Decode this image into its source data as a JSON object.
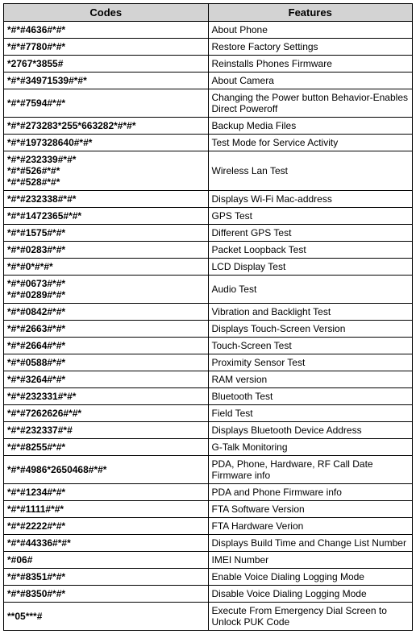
{
  "headers": {
    "codes": "Codes",
    "features": "Features"
  },
  "rows": [
    {
      "code": "*#*#4636#*#*",
      "feature": "About Phone"
    },
    {
      "code": "*#*#7780#*#*",
      "feature": "Restore Factory Settings"
    },
    {
      "code": "*2767*3855#",
      "feature": "Reinstalls Phones Firmware"
    },
    {
      "code": "*#*#34971539#*#*",
      "feature": "About Camera"
    },
    {
      "code": "*#*#7594#*#*",
      "feature": "Changing the Power button Behavior-Enables Direct Poweroff"
    },
    {
      "code": "*#*#273283*255*663282*#*#*",
      "feature": "Backup Media Files"
    },
    {
      "code": "*#*#197328640#*#*",
      "feature": "Test Mode for Service Activity"
    },
    {
      "code_lines": [
        "*#*#232339#*#*",
        "*#*#526#*#*",
        "*#*#528#*#*"
      ],
      "feature": "Wireless Lan Test"
    },
    {
      "code": "*#*#232338#*#*",
      "feature": "Displays Wi-Fi Mac-address"
    },
    {
      "code": "*#*#1472365#*#*",
      "feature": "GPS Test"
    },
    {
      "code": "*#*#1575#*#*",
      "feature": "Different GPS Test"
    },
    {
      "code": "*#*#0283#*#*",
      "feature": "Packet Loopback Test"
    },
    {
      "code": "*#*#0*#*#*",
      "feature": "LCD Display Test"
    },
    {
      "code_lines": [
        "*#*#0673#*#*",
        "*#*#0289#*#*"
      ],
      "feature": "Audio Test"
    },
    {
      "code": "*#*#0842#*#*",
      "feature": "Vibration and Backlight Test"
    },
    {
      "code": "*#*#2663#*#*",
      "feature": "Displays Touch-Screen Version"
    },
    {
      "code": "*#*#2664#*#*",
      "feature": "Touch-Screen Test"
    },
    {
      "code": "*#*#0588#*#*",
      "feature": "Proximity Sensor Test"
    },
    {
      "code": "*#*#3264#*#*",
      "feature": "RAM version"
    },
    {
      "code": "*#*#232331#*#*",
      "feature": "Bluetooth Test"
    },
    {
      "code": "*#*#7262626#*#*",
      "feature": "Field Test"
    },
    {
      "code": "*#*#232337#*#",
      "feature": "Displays Bluetooth Device Address"
    },
    {
      "code": "*#*#8255#*#*",
      "feature": "G-Talk Monitoring"
    },
    {
      "code": "*#*#4986*2650468#*#*",
      "feature": "PDA, Phone, Hardware, RF Call Date Firmware info"
    },
    {
      "code": "*#*#1234#*#*",
      "feature": "PDA and Phone Firmware info"
    },
    {
      "code": "*#*#1111#*#*",
      "feature": "FTA Software Version"
    },
    {
      "code": "*#*#2222#*#*",
      "feature": "FTA Hardware Verion"
    },
    {
      "code": "*#*#44336#*#*",
      "feature": "Displays Build Time and Change List Number"
    },
    {
      "code": "*#06#",
      "feature": "IMEI Number"
    },
    {
      "code": "*#*#8351#*#*",
      "feature": "Enable Voice Dialing Logging Mode"
    },
    {
      "code": "*#*#8350#*#*",
      "feature": "Disable Voice Dialing Logging Mode"
    },
    {
      "code": "**05***#",
      "feature": "Execute From Emergency Dial Screen to Unlock PUK Code"
    }
  ]
}
